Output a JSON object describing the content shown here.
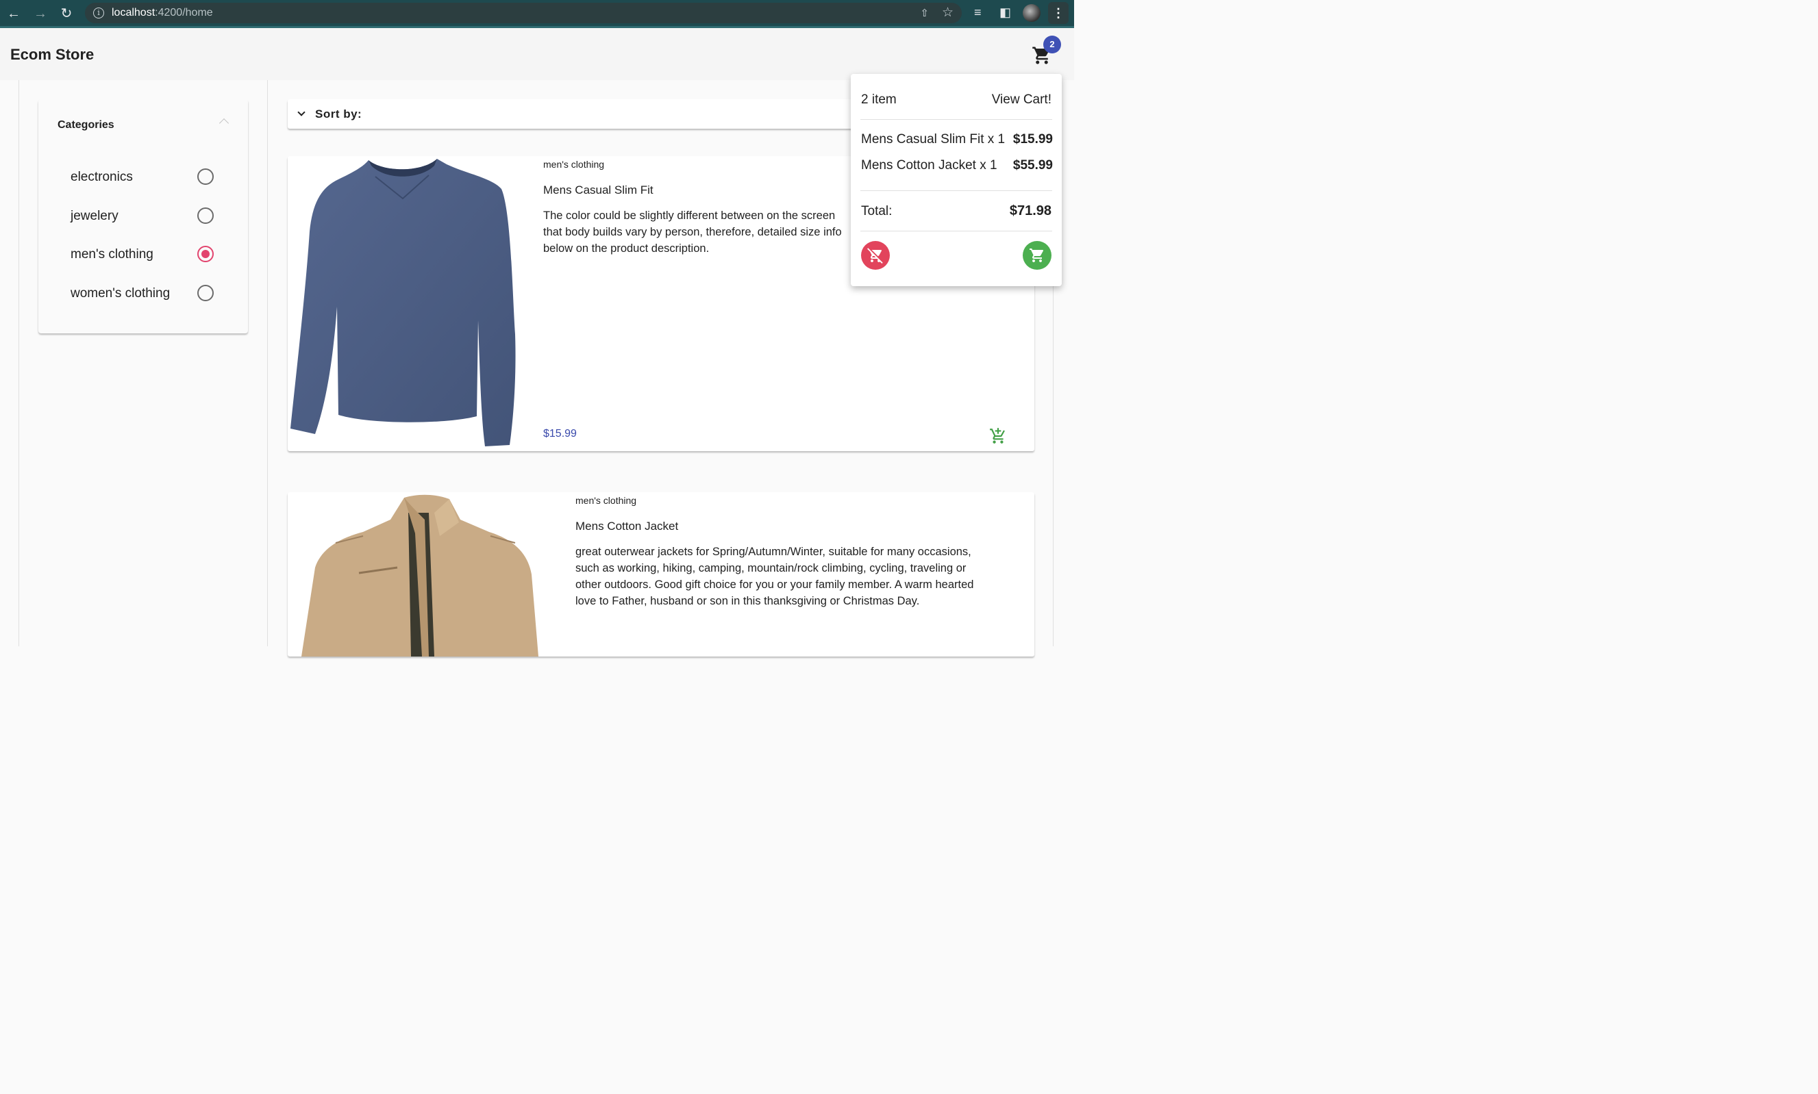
{
  "browser": {
    "url_host": "localhost",
    "url_path": ":4200/home"
  },
  "header": {
    "title": "Ecom Store",
    "cart_badge": "2"
  },
  "categories": {
    "title": "Categories",
    "items": [
      {
        "label": "electronics",
        "checked": false
      },
      {
        "label": "jewelery",
        "checked": false
      },
      {
        "label": "men's clothing",
        "checked": true
      },
      {
        "label": "women's clothing",
        "checked": false
      }
    ]
  },
  "sort": {
    "label": "Sort by:"
  },
  "products": [
    {
      "category": "men's clothing",
      "name": "Mens Casual Slim Fit",
      "description_lines": [
        "The color could be slightly different between on the screen",
        "that body builds vary by person, therefore, detailed size info",
        "below on the product description."
      ],
      "price": "$15.99"
    },
    {
      "category": "men's clothing",
      "name": "Mens Cotton Jacket",
      "description_lines": [
        "great outerwear jackets for Spring/Autumn/Winter, suitable for many occasions,",
        "such as working, hiking, camping, mountain/rock climbing, cycling, traveling or",
        "other outdoors. Good gift choice for you or your family member. A warm hearted",
        "love to Father, husband or son in this thanksgiving or Christmas Day."
      ],
      "price": ""
    }
  ],
  "cart_popup": {
    "count_label": "2 item",
    "view_cart": "View Cart!",
    "items": [
      {
        "label": "Mens Casual Slim Fit x 1",
        "price": "$15.99"
      },
      {
        "label": "Mens Cotton Jacket x 1",
        "price": "$55.99"
      }
    ],
    "total_label": "Total:",
    "total_value": "$71.98"
  },
  "colors": {
    "accent": "#e2446e",
    "primary": "#3f51b5",
    "success": "#4caf50",
    "danger": "#e2445c",
    "price": "#3949ab"
  },
  "icons": [
    "back-arrow-icon",
    "forward-arrow-icon",
    "reload-icon",
    "info-icon",
    "share-icon",
    "star-icon",
    "reading-list-icon",
    "side-panel-icon",
    "kebab-menu-icon",
    "cart-icon",
    "chevron-up-icon",
    "chevron-down-icon",
    "remove-cart-icon",
    "add-cart-icon"
  ]
}
